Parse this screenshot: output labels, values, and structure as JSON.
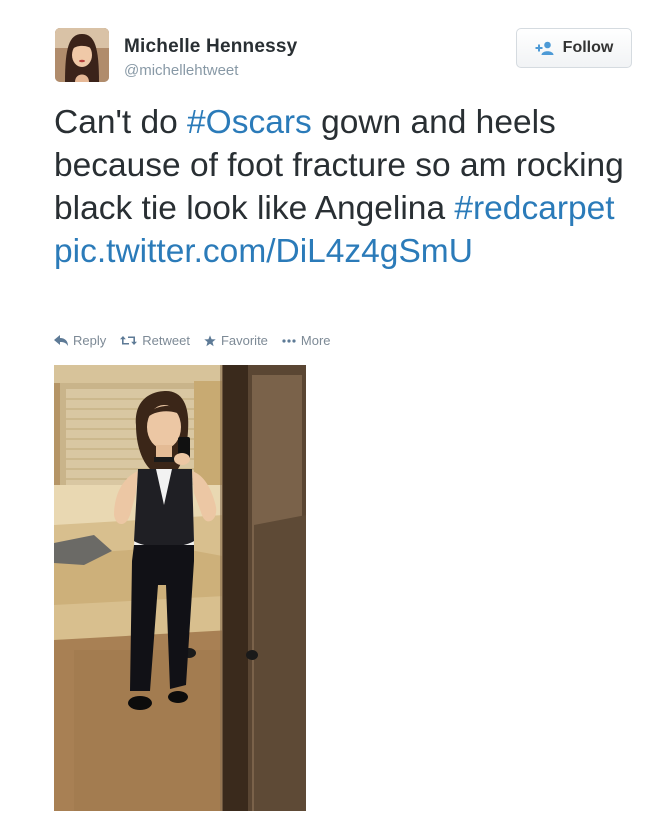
{
  "user": {
    "name": "Michelle Hennessy",
    "handle": "@michellehtweet",
    "follow_label": "Follow"
  },
  "tweet": {
    "segments": [
      {
        "text": "Can't do ",
        "kind": "plain"
      },
      {
        "text": "#Oscars",
        "kind": "hashtag"
      },
      {
        "text": " gown and heels because of foot fracture so am rocking black tie look like Angelina ",
        "kind": "plain"
      },
      {
        "text": "#redcarpet",
        "kind": "hashtag"
      },
      {
        "text": " ",
        "kind": "plain"
      },
      {
        "text": "pic.twitter.com/DiL4z4gSmU",
        "kind": "link"
      }
    ]
  },
  "actions": {
    "reply": "Reply",
    "retweet": "Retweet",
    "favorite": "Favorite",
    "more": "More"
  },
  "icons": {
    "follow": "add-user-icon",
    "reply": "reply-arrow-icon",
    "retweet": "retweet-arrows-icon",
    "favorite": "star-icon",
    "more": "ellipsis-icon"
  },
  "colors": {
    "link": "#2b7bb9",
    "text": "#292f33",
    "muted": "#8899a6",
    "action": "#7d8a96"
  }
}
